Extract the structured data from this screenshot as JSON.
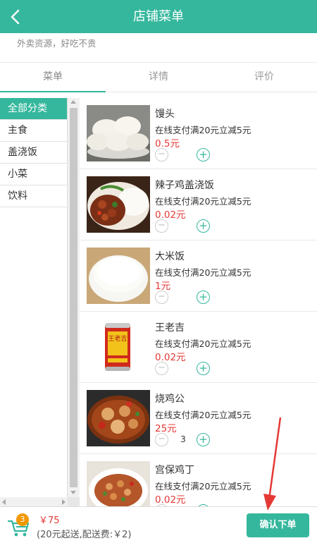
{
  "header": {
    "title": "店铺菜单"
  },
  "shop": {
    "slogan": "外卖资源，好吃不贵"
  },
  "tabs": [
    {
      "label": "菜单"
    },
    {
      "label": "详情"
    },
    {
      "label": "评价"
    }
  ],
  "categories": [
    {
      "label": "全部分类"
    },
    {
      "label": "主食"
    },
    {
      "label": "盖浇饭"
    },
    {
      "label": "小菜"
    },
    {
      "label": "饮料"
    }
  ],
  "items": [
    {
      "name": "馒头",
      "promo": "在线支付满20元立减5元",
      "price": "0.5元",
      "qty": ""
    },
    {
      "name": "辣子鸡盖浇饭",
      "promo": "在线支付满20元立减5元",
      "price": "0.02元",
      "qty": ""
    },
    {
      "name": "大米饭",
      "promo": "在线支付满20元立减5元",
      "price": "1元",
      "qty": ""
    },
    {
      "name": "王老吉",
      "promo": "在线支付满20元立减5元",
      "price": "0.02元",
      "qty": ""
    },
    {
      "name": "烧鸡公",
      "promo": "在线支付满20元立减5元",
      "price": "25元",
      "qty": "3"
    },
    {
      "name": "宫保鸡丁",
      "promo": "在线支付满20元立减5元",
      "price": "0.02元",
      "qty": ""
    }
  ],
  "drink_label": "王老吉",
  "footer": {
    "cart_count": "3",
    "total": "￥75",
    "fee_text": "(20元起送,配送费:￥2)",
    "confirm_label": "确认下单"
  },
  "colors": {
    "brand": "#35b79d",
    "price": "#e53935",
    "badge": "#f39800",
    "annotation": "#e53935"
  },
  "icons": {
    "back": "chevron-left-icon",
    "cart": "shopping-cart-icon",
    "minus": "minus-circle-icon",
    "plus": "plus-circle-icon"
  }
}
